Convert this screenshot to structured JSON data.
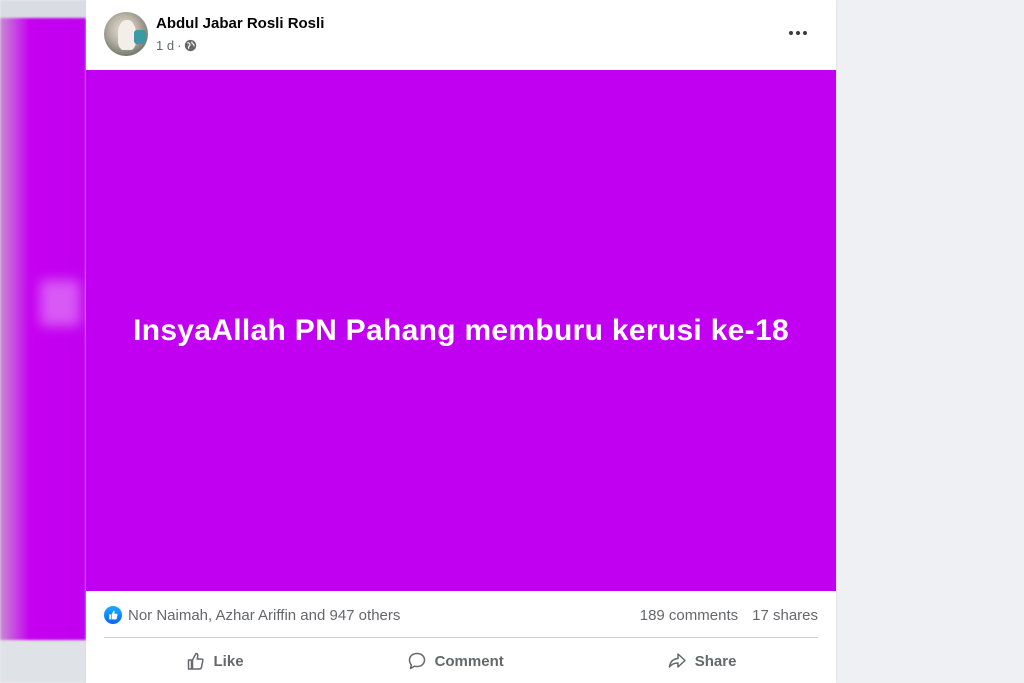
{
  "post": {
    "author": "Abdul Jabar Rosli Rosli",
    "time": "1 d",
    "separator": "·",
    "privacy_icon": "globe-icon",
    "text": "InsyaAllah PN Pahang memburu kerusi ke-18",
    "background_color": "#c100f2"
  },
  "reactions": {
    "icon": "like-icon",
    "summary": "Nor Naimah, Azhar Ariffin and 947 others",
    "comments": "189 comments",
    "shares": "17 shares"
  },
  "actions": {
    "like_label": "Like",
    "comment_label": "Comment",
    "share_label": "Share"
  }
}
